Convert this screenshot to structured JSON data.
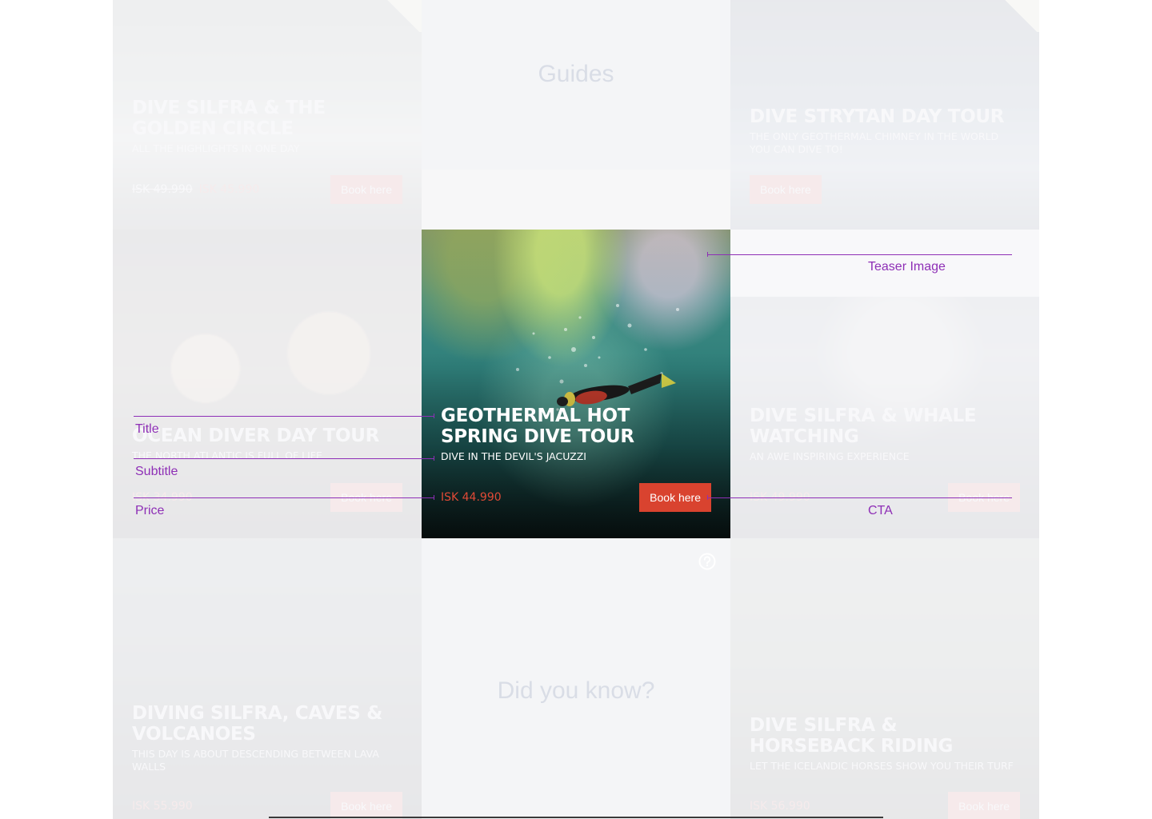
{
  "tiles": {
    "guides": "Guides",
    "did_you_know": "Did you know?"
  },
  "tours": [
    {
      "title": "Dive Silfra & the Golden Circle",
      "subtitle": "All the highlights in one day",
      "price_old": "ISK 49.990",
      "price": "ISK 45.990",
      "cta": "Book here"
    },
    {
      "title": "Dive Strytan Day Tour",
      "subtitle": "The only geothermal chimney in the world you can dive to!",
      "cta": "Book here"
    },
    {
      "title": "Ocean Diver Day Tour",
      "subtitle": "The North Atlantic is full of life",
      "price": "ISK 34.990",
      "cta": "Book here"
    },
    {
      "title": "Geothermal Hot Spring Dive Tour",
      "subtitle": "Dive in the Devil's Jacuzzi",
      "price": "ISK 44.990",
      "cta": "Book here"
    },
    {
      "title": "Dive Silfra & Whale Watching",
      "subtitle": "An awe inspiring experience",
      "price": "ISK 49.990",
      "cta": "Book here"
    },
    {
      "title": "Diving Silfra, Caves & Volcanoes",
      "subtitle": "This day is about descending between lava walls",
      "price": "ISK 55.990",
      "cta": "Book here"
    },
    {
      "title": "Dive Silfra & Horseback Riding",
      "subtitle": "Let the Icelandic horses show you their turf",
      "price": "ISK 56.990",
      "cta": "Book here"
    }
  ],
  "annotations": {
    "title": "Title",
    "subtitle": "Subtitle",
    "price": "Price",
    "teaser_image": "Teaser Image",
    "cta": "CTA"
  },
  "colors": {
    "cta_background": "#d9432f",
    "price_text": "#e04a36",
    "annotation": "#8e2fb6"
  },
  "icons": {
    "help": "question-circle-icon"
  }
}
